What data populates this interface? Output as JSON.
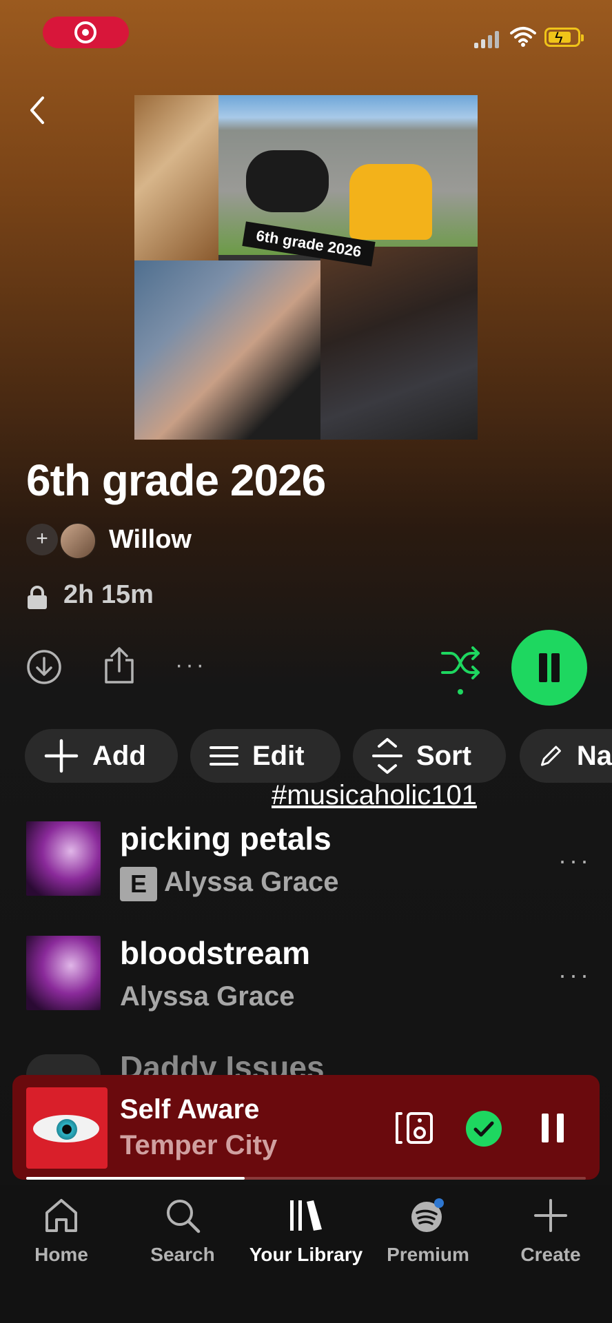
{
  "playlist": {
    "cover_label": "6th grade 2026",
    "title": "6th grade 2026",
    "owner": "Willow",
    "duration": "2h 15m"
  },
  "chips": {
    "add": "Add",
    "edit": "Edit",
    "sort": "Sort",
    "name": "Na"
  },
  "overlay": {
    "hashtag": "#musicaholic101"
  },
  "tracks": [
    {
      "title": "picking petals",
      "artist": "Alyssa Grace",
      "explicit": "E"
    },
    {
      "title": "bloodstream",
      "artist": "Alyssa Grace"
    },
    {
      "title": "Daddy Issues"
    }
  ],
  "now_playing": {
    "title": "Self Aware",
    "artist": "Temper City",
    "progress": 0.39
  },
  "nav": [
    {
      "label": "Home",
      "icon": "home-icon"
    },
    {
      "label": "Search",
      "icon": "search-icon"
    },
    {
      "label": "Your Library",
      "icon": "library-icon"
    },
    {
      "label": "Premium",
      "icon": "spotify-icon"
    },
    {
      "label": "Create",
      "icon": "plus-icon"
    }
  ],
  "colors": {
    "accent": "#1ed760",
    "mini_player": "#6a0a0d",
    "recording": "#d8163a"
  }
}
